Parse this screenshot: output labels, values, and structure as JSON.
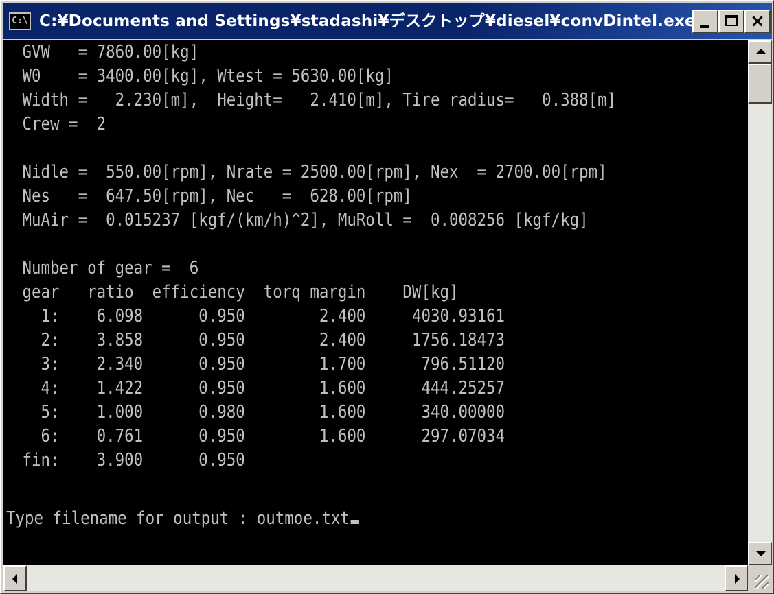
{
  "window": {
    "title": "C:¥Documents and Settings¥stadashi¥デスクトップ¥diesel¥convDintel.exe",
    "icon_text": "C:\\",
    "close_glyph": "×",
    "colors": {
      "titlebar": "#0a246a",
      "console_bg": "#000000",
      "console_fg": "#c0c0c0"
    }
  },
  "console": {
    "lines": [
      " GVW   = 7860.00[kg]",
      " W0    = 3400.00[kg], Wtest = 5630.00[kg]",
      " Width =   2.230[m],  Height=   2.410[m], Tire radius=   0.388[m]",
      " Crew =  2",
      "",
      " Nidle =  550.00[rpm], Nrate = 2500.00[rpm], Nex  = 2700.00[rpm]",
      " Nes   =  647.50[rpm], Nec   =  628.00[rpm]",
      " MuAir =  0.015237 [kgf/(km/h)^2], MuRoll =  0.008256 [kgf/kg]",
      "",
      " Number of gear =  6",
      " gear   ratio  efficiency  torq margin    DW[kg]",
      "   1:    6.098      0.950        2.400     4030.93161",
      "   2:    3.858      0.950        2.400     1756.18473",
      "   3:    2.340      0.950        1.700      796.51120",
      "   4:    1.422      0.950        1.600      444.25257",
      "   5:    1.000      0.980        1.600      340.00000",
      "   6:    0.761      0.950        1.600      297.07034",
      " fin:    3.900      0.950"
    ],
    "prompt": "Type filename for output : outmoe.txt"
  },
  "scrollbars": {
    "vertical": "scrollbar-vertical",
    "horizontal": "scrollbar-horizontal"
  }
}
